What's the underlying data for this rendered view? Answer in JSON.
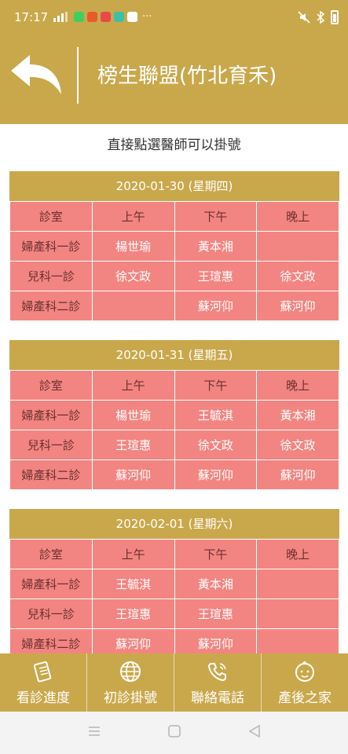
{
  "status_bar": {
    "time": "17:17",
    "more_dots": "···"
  },
  "header": {
    "title": "榜生聯盟(竹北育禾)"
  },
  "subtitle": "直接點選醫師可以掛號",
  "columns": [
    "診室",
    "上午",
    "下午",
    "晚上"
  ],
  "days": [
    {
      "date_label": "2020-01-30 (星期四)",
      "rows": [
        {
          "room": "婦產科一診",
          "am": "楊世瑜",
          "pm": "黃本湘",
          "eve": ""
        },
        {
          "room": "兒科一診",
          "am": "徐文政",
          "pm": "王瑄惠",
          "eve": "徐文政"
        },
        {
          "room": "婦產科二診",
          "am": "",
          "pm": "蘇河仰",
          "eve": "蘇河仰"
        }
      ]
    },
    {
      "date_label": "2020-01-31 (星期五)",
      "rows": [
        {
          "room": "婦產科一診",
          "am": "楊世瑜",
          "pm": "王毓淇",
          "eve": "黃本湘"
        },
        {
          "room": "兒科一診",
          "am": "王瑄惠",
          "pm": "徐文政",
          "eve": "徐文政"
        },
        {
          "room": "婦產科二診",
          "am": "蘇河仰",
          "pm": "蘇河仰",
          "eve": "蘇河仰"
        }
      ]
    },
    {
      "date_label": "2020-02-01 (星期六)",
      "rows": [
        {
          "room": "婦產科一診",
          "am": "王毓淇",
          "pm": "黃本湘",
          "eve": ""
        },
        {
          "room": "兒科一診",
          "am": "王瑄惠",
          "pm": "王瑄惠",
          "eve": ""
        },
        {
          "room": "婦產科二診",
          "am": "蘇河仰",
          "pm": "蘇河仰",
          "eve": ""
        }
      ]
    }
  ],
  "bottom_nav": [
    {
      "label": "看診進度",
      "icon": "clipboard-icon"
    },
    {
      "label": "初診掛號",
      "icon": "globe-icon"
    },
    {
      "label": "聯絡電話",
      "icon": "phone-icon"
    },
    {
      "label": "產後之家",
      "icon": "baby-icon"
    }
  ],
  "colors": {
    "accent": "#c9a84c",
    "cell": "#f28581",
    "room_text": "#6b2f2f"
  }
}
